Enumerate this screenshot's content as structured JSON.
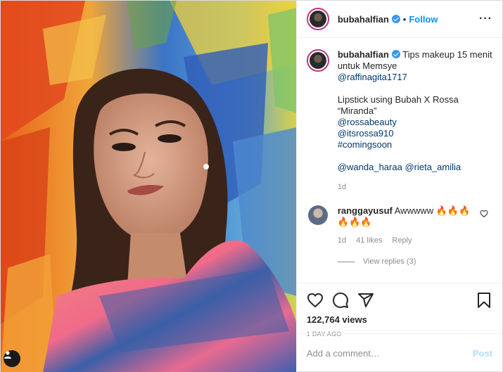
{
  "post": {
    "username": "bubahalfian",
    "separator": "•",
    "follow_label": "Follow",
    "more_label": "···"
  },
  "caption": {
    "username": "bubahalfian",
    "line1": "Tips makeup 15 menit untuk Memsye",
    "mention1": "@raffinagita1717",
    "line2": "Lipstick using Bubah X Rossa",
    "line3": "“Miranda”",
    "mention2": "@rossabeauty",
    "mention3": "@itsrossa910",
    "hashtag": "#comingsoon",
    "mention4": "@wanda_haraa",
    "mention5": "@rieta_amilia",
    "time": "1d"
  },
  "comment": {
    "username": "ranggayusuf",
    "text": "Awwwww 🔥🔥🔥🔥🔥🔥",
    "time": "1d",
    "likes": "41 likes",
    "reply_label": "Reply",
    "view_replies": "View replies (3)"
  },
  "stats": {
    "views": "122,764 views",
    "date": "1 DAY AGO"
  },
  "composer": {
    "placeholder": "Add a comment…",
    "post_label": "Post"
  },
  "icons": {
    "more": "more-options-icon",
    "heart": "heart-icon",
    "comment": "comment-icon",
    "share": "share-icon",
    "bookmark": "bookmark-icon",
    "verified": "verified-badge-icon",
    "user": "user-tag-icon"
  },
  "colors": {
    "link": "#00376b",
    "follow": "#0095f6",
    "verified": "#3897f0",
    "muted": "#8e8e8e"
  }
}
